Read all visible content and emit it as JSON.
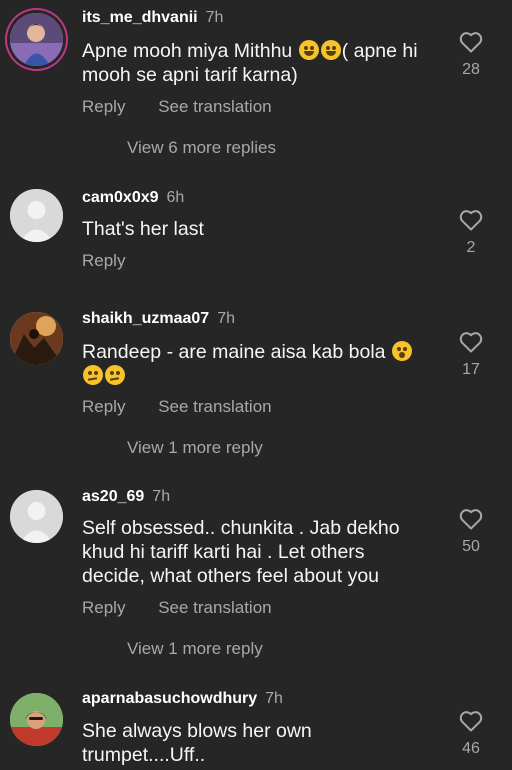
{
  "comments": [
    {
      "username": "its_me_dhvanii",
      "time": "7h",
      "text": "Apne mooh miya Mithhu",
      "text_tail": "( apne hi mooh se apni tarif karna)",
      "likes": "28",
      "reply_label": "Reply",
      "translate_label": "See translation",
      "more_replies": "View 6 more replies"
    },
    {
      "username": "cam0x0x9",
      "time": "6h",
      "text": "That's her last",
      "likes": "2",
      "reply_label": "Reply"
    },
    {
      "username": "shaikh_uzmaa07",
      "time": "7h",
      "text": "Randeep - are maine aisa kab bola",
      "likes": "17",
      "reply_label": "Reply",
      "translate_label": "See translation",
      "more_replies": "View 1 more reply"
    },
    {
      "username": "as20_69",
      "time": "7h",
      "text": "Self obsessed.. chunkita . Jab dekho khud hi tariff karti hai . Let others decide, what others feel about you",
      "likes": "50",
      "reply_label": "Reply",
      "translate_label": "See translation",
      "more_replies": "View 1 more reply"
    },
    {
      "username": "aparnabasuchowdhury",
      "time": "7h",
      "text": "She always blows her own trumpet....Uff..",
      "likes": "46"
    }
  ],
  "icons": {
    "like": "heart-outline-icon",
    "default_avatar": "person-silhouette-icon"
  },
  "colors": {
    "background": "#262626",
    "text": "#f5f5f5",
    "muted": "#a8a8a8"
  }
}
